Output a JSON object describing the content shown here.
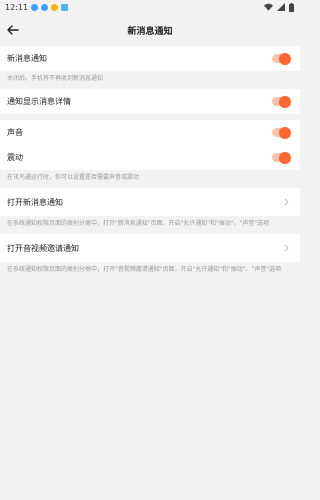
{
  "status_bar": {
    "time": "12:11",
    "icons": [
      "notification-app-icon",
      "notification-app-icon",
      "notification-app-icon",
      "notification-app-icon"
    ],
    "right_icons": [
      "wifi-icon",
      "signal-icon",
      "battery-icon"
    ]
  },
  "header": {
    "title": "新消息通知",
    "back_icon": "back-arrow-icon"
  },
  "settings": {
    "new_message": {
      "label": "新消息通知",
      "enabled": true
    },
    "new_message_hint": "关闭后，手机将不再收到新消息通知",
    "show_detail": {
      "label": "通知显示消息详情",
      "enabled": true
    },
    "sound": {
      "label": "声音",
      "enabled": true
    },
    "vibrate": {
      "label": "震动",
      "enabled": true
    },
    "sound_hint": "在讯鸟通运行时，你可以设置是否需要声音或震动",
    "open_notification": {
      "label": "打开新消息通知"
    },
    "open_notification_hint": "在系统通知权限页面的类别分类中，打开\"新消息通知\"页面，开启\"允许通知\"和\"振动\"、\"声音\"选项",
    "open_av_notification": {
      "label": "打开音视频邀请通知"
    },
    "open_av_notification_hint": "在系统通知权限页面的类别分类中，打开\"音视频邀请通知\"页面，开启\"允许通知\"和\"振动\"、\"声音\"选项"
  },
  "colors": {
    "accent": "#ff6633",
    "track": "#f9c4ad",
    "background": "#f2f2f2",
    "card": "#ffffff"
  }
}
